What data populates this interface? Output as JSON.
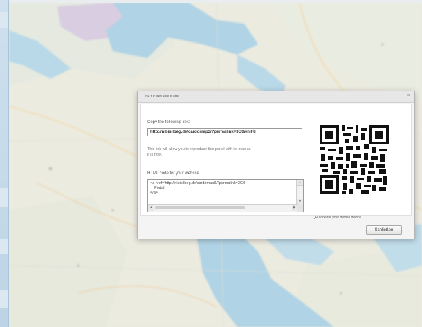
{
  "dialog": {
    "title": "Link für aktuelle Karte",
    "close_symbol": "×",
    "copy_label": "Copy the following link:",
    "permalink": "http://nibis.lbeg.de/cardomap3/?permalink=3G0wnlF8",
    "reproduce_text": "This link will allow you to reproduce this portal with its map as it is now.",
    "html_code_label": "HTML code for your website",
    "html_code": "<a href='http://nibis.lbeg.de/cardomap3/?permalink=3G0\n    Portal\n</a>",
    "qr_caption": "QR code for your mobile device",
    "close_button_label": "Schließen"
  },
  "scroll": {
    "up": "▲",
    "down": "▼",
    "left": "◀",
    "right": "▶"
  },
  "icons": [
    "close-icon",
    "qr-code-icon"
  ],
  "colors": {
    "water": "#9ccbe6",
    "dialog_bg": "#f4f4f4",
    "header_bg": "#e7e7e7"
  }
}
